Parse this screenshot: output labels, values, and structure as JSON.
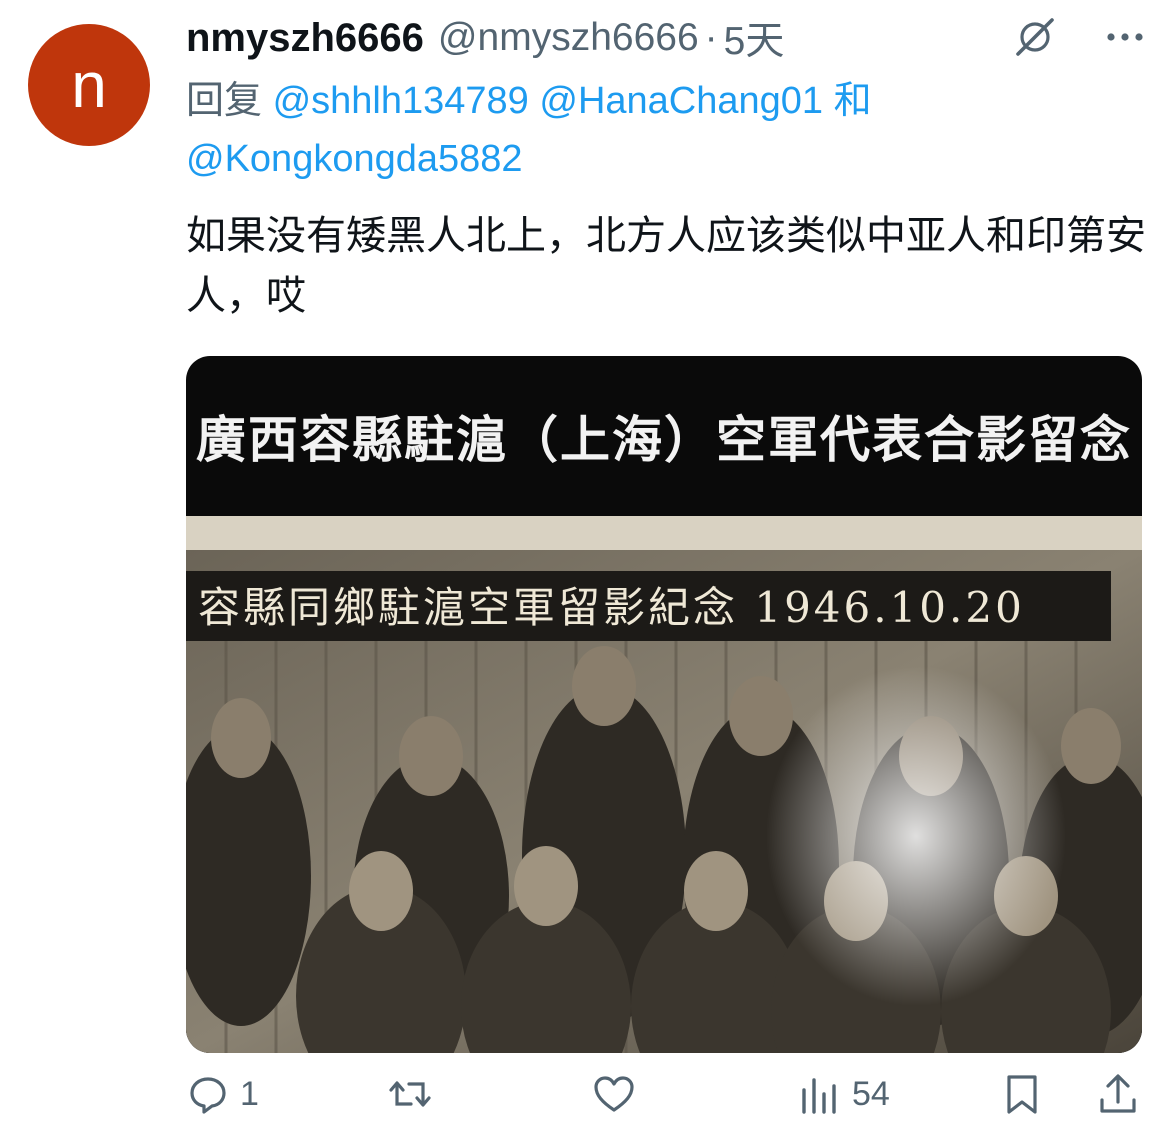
{
  "tweet": {
    "avatar_letter": "n",
    "avatar_color": "#bf360c",
    "display_name": "nmyszh6666",
    "handle": "@nmyszh6666",
    "separator": "·",
    "time": "5天",
    "reply_prefix": "回复",
    "mentions": [
      "@shhlh134789",
      "@HanaChang01",
      "@Kongkongda5882"
    ],
    "mention_joiner": "和",
    "text": "如果没有矮黑人北上，北方人应该类似中亚人和印第安人，哎",
    "media": {
      "caption": "廣西容縣駐滬（上海）空軍代表合影留念",
      "banner_text": "容縣同鄉駐滬空軍留影紀念 1946.10.20"
    },
    "actions": {
      "reply_count": "1",
      "views_count": "54"
    }
  },
  "icons": {
    "header": [
      "grok-icon",
      "more-icon"
    ],
    "actions": [
      "reply-icon",
      "retweet-icon",
      "like-icon",
      "views-icon",
      "bookmark-icon",
      "share-icon"
    ]
  },
  "colors": {
    "link": "#1d9bf0",
    "secondary_text": "#536471",
    "primary_text": "#0f1419"
  }
}
